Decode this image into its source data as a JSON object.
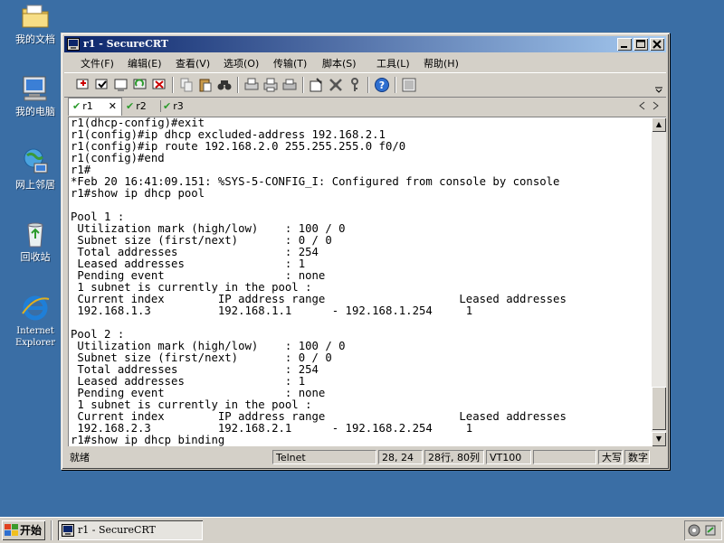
{
  "desktop": {
    "icons": [
      {
        "label": "我的文档"
      },
      {
        "label": "我的电脑"
      },
      {
        "label": "网上邻居"
      },
      {
        "label": "回收站"
      },
      {
        "label": "Internet Explorer"
      }
    ]
  },
  "window": {
    "title": "r1 - SecureCRT",
    "menu": [
      "文件(F)",
      "编辑(E)",
      "查看(V)",
      "选项(O)",
      "传输(T)",
      "脚本(S)",
      "工具(L)",
      "帮助(H)"
    ],
    "tabs": [
      {
        "label": "r1",
        "active": true,
        "close": "✕"
      },
      {
        "label": "r2",
        "active": false
      },
      {
        "label": "r3",
        "active": false
      }
    ],
    "terminal_lines": [
      "r1(dhcp-config)#exit",
      "r1(config)#ip dhcp excluded-address 192.168.2.1",
      "r1(config)#ip route 192.168.2.0 255.255.255.0 f0/0",
      "r1(config)#end",
      "r1#",
      "*Feb 20 16:41:09.151: %SYS-5-CONFIG_I: Configured from console by console",
      "r1#show ip dhcp pool",
      "",
      "Pool 1 :",
      " Utilization mark (high/low)    : 100 / 0",
      " Subnet size (first/next)       : 0 / 0",
      " Total addresses                : 254",
      " Leased addresses               : 1",
      " Pending event                  : none",
      " 1 subnet is currently in the pool :",
      " Current index        IP address range                    Leased addresses",
      " 192.168.1.3          192.168.1.1      - 192.168.1.254     1",
      "",
      "Pool 2 :",
      " Utilization mark (high/low)    : 100 / 0",
      " Subnet size (first/next)       : 0 / 0",
      " Total addresses                : 254",
      " Leased addresses               : 1",
      " Pending event                  : none",
      " 1 subnet is currently in the pool :",
      " Current index        IP address range                    Leased addresses",
      " 192.168.2.3          192.168.2.1      - 192.168.2.254     1",
      "r1#show ip dhcp binding"
    ],
    "status": {
      "ready": "就绪",
      "protocol": "Telnet",
      "cursor": "28, 24",
      "size": "28行, 80列",
      "emulation": "VT100",
      "caps": "大写",
      "num": "数字"
    }
  },
  "taskbar": {
    "start": "开始",
    "task": "r1 - SecureCRT"
  },
  "colors": {
    "desktop": "#3a6ea5",
    "title_start": "#0a246a",
    "title_end": "#a6caf0",
    "chrome": "#d4d0c8"
  }
}
